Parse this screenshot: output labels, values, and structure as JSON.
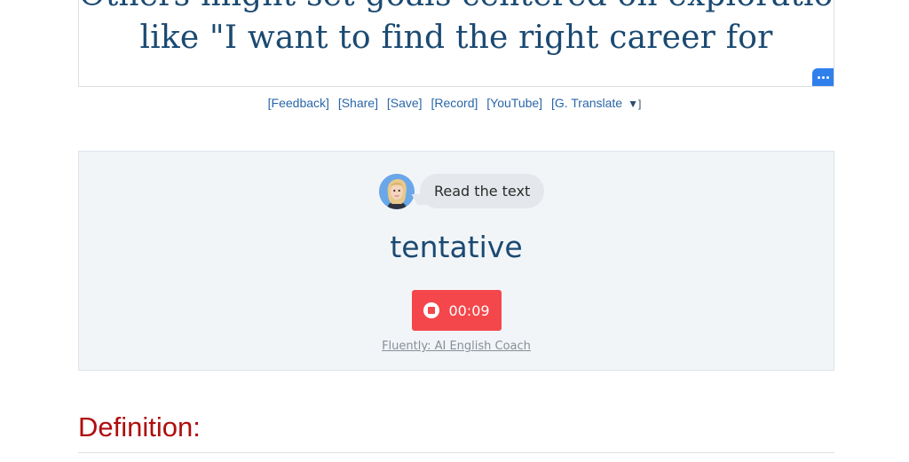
{
  "passage": {
    "line1": "Others might set goals centered on exploration,",
    "line2": "like \"I want to find the right career for"
  },
  "more_button": {
    "icon": "ellipsis-icon",
    "color": "#2f80ed"
  },
  "links": {
    "feedback": "[Feedback]",
    "share": "[Share]",
    "save": "[Save]",
    "record": "[Record]",
    "youtube": "[YouTube]",
    "translate": "[G. Translate",
    "translate_caret": "▼]"
  },
  "coach": {
    "bubble_text": "Read the text",
    "word": "tentative",
    "timer": "00:09",
    "footer_link": "Fluently: AI English Coach",
    "record_color": "#f4474b"
  },
  "definition": {
    "heading": "Definition:",
    "heading_color": "#b00d0d"
  }
}
